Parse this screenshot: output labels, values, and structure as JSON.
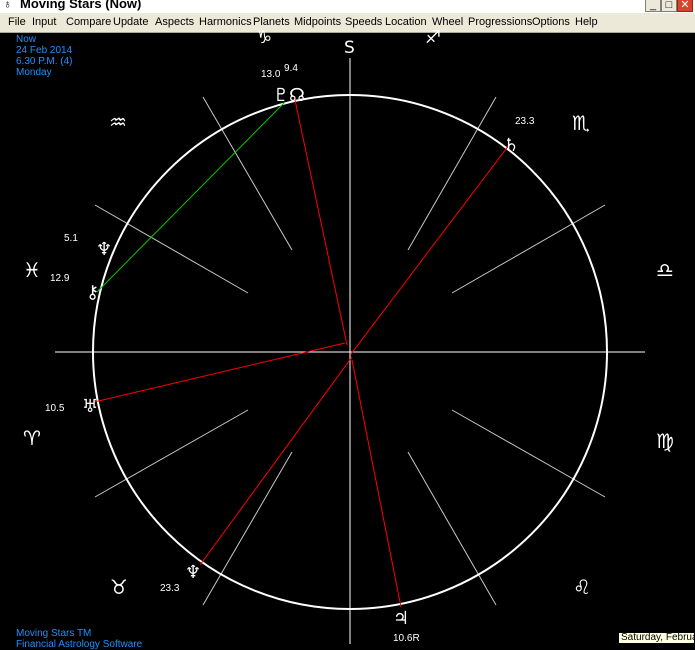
{
  "window": {
    "title": "Moving Stars (Now)",
    "minimize": "_",
    "maximize": "□",
    "close": "✕"
  },
  "menu": [
    "File",
    "Input",
    "Compare",
    "Update",
    "Aspects",
    "Harmonics",
    "Planets",
    "Midpoints",
    "Speeds",
    "Location",
    "Wheel",
    "Progressions",
    "Options",
    "Help"
  ],
  "chart_info": {
    "label": "Now",
    "date": "24 Feb 2014",
    "time": "6.30 P.M. (4)",
    "weekday": "Monday"
  },
  "footer": {
    "line1": "Moving Stars TM",
    "line2": "Financial Astrology Software"
  },
  "status_tooltip": "Saturday, Februa",
  "wheel": {
    "zodiac": [
      {
        "name": "aquarius-sign",
        "glyph": "♒"
      },
      {
        "name": "pisces-sign",
        "glyph": "♓"
      },
      {
        "name": "aries-sign",
        "glyph": "♈"
      },
      {
        "name": "taurus-sign",
        "glyph": "♉"
      },
      {
        "name": "leo-sign",
        "glyph": "♌"
      },
      {
        "name": "virgo-sign",
        "glyph": "♍"
      },
      {
        "name": "libra-sign",
        "glyph": "♎"
      },
      {
        "name": "scorpio-sign",
        "glyph": "♏"
      },
      {
        "name": "sagittarius-sign",
        "glyph": "♐"
      },
      {
        "name": "capricorn-sign",
        "glyph": "♑"
      }
    ],
    "direction_label": "S",
    "planets": [
      {
        "name": "pluto",
        "glyph": "♇",
        "degree": "13.0"
      },
      {
        "name": "north-node",
        "glyph": "☊",
        "degree": "9.4"
      },
      {
        "name": "saturn",
        "glyph": "♄",
        "degree": "23.3"
      },
      {
        "name": "neptune",
        "glyph": "♆",
        "degree": "5.1"
      },
      {
        "name": "chiron",
        "glyph": "⚷",
        "degree": "12.9"
      },
      {
        "name": "uranus",
        "glyph": "♅",
        "degree": "10.5"
      },
      {
        "name": "neptune-lower",
        "glyph": "♆",
        "degree": "23.3"
      },
      {
        "name": "jupiter",
        "glyph": "♃",
        "degree": "10.6R"
      }
    ],
    "colors": {
      "circle": "#ffffff",
      "aspect_red": "#ff0000",
      "aspect_green": "#00cc00",
      "info_text": "#1e90ff"
    }
  }
}
